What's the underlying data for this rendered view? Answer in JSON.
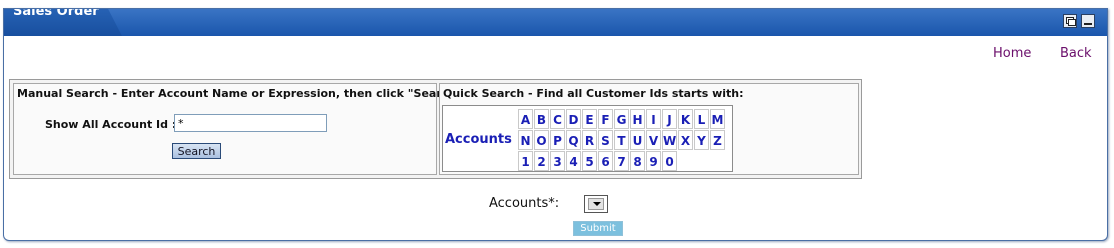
{
  "window": {
    "title": "Sales Order",
    "restore_icon": "restore-window-icon",
    "minimize_icon": "minimize-window-icon"
  },
  "nav": {
    "home": "Home",
    "back": "Back"
  },
  "manual_search": {
    "title": "Manual Search - Enter Account Name or Expression, then click \"Search\":",
    "show_all_label": "Show All Account Id :",
    "input_value": "*",
    "search_button": "Search"
  },
  "quick_search": {
    "title": "Quick Search - Find all Customer Ids starts with:",
    "accounts_label": "Accounts",
    "rows": [
      [
        "A",
        "B",
        "C",
        "D",
        "E",
        "F",
        "G",
        "H",
        "I",
        "J",
        "K",
        "L",
        "M"
      ],
      [
        "N",
        "O",
        "P",
        "Q",
        "R",
        "S",
        "T",
        "U",
        "V",
        "W",
        "X",
        "Y",
        "Z"
      ],
      [
        "1",
        "2",
        "3",
        "4",
        "5",
        "6",
        "7",
        "8",
        "9",
        "0"
      ]
    ]
  },
  "accounts_select": {
    "label": "Accounts*:",
    "selected": ""
  },
  "submit_button": "Submit",
  "colors": {
    "header": "#1a56ac",
    "link": "#6b0f6b",
    "letter": "#1a1fb5",
    "submit": "#7cc0de"
  }
}
